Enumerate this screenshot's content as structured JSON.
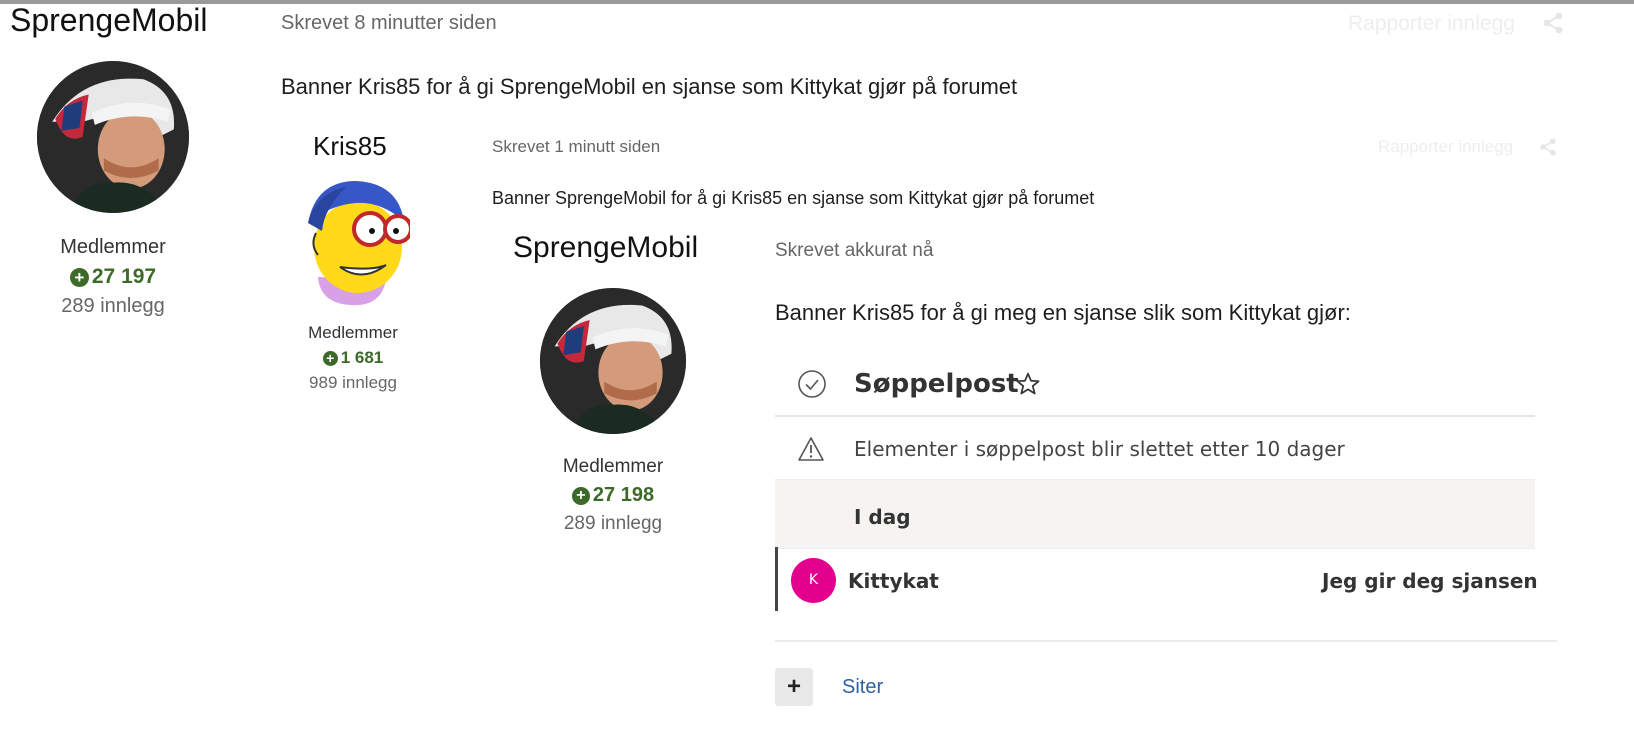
{
  "post1": {
    "author": "SprengeMobil",
    "time": "Skrevet 8 minutter siden",
    "report": "Rapporter innlegg",
    "group": "Medlemmer",
    "reputation": "27 197",
    "posts": "289 innlegg",
    "body": "Banner Kris85 for å gi SprengeMobil en sjanse som Kittykat gjør på forumet"
  },
  "post2": {
    "author": "Kris85",
    "time": "Skrevet 1 minutt siden",
    "report": "Rapporter innlegg",
    "group": "Medlemmer",
    "reputation": "1 681",
    "posts": "989 innlegg",
    "body": "Banner SprengeMobil for å gi Kris85 en sjanse som Kittykat gjør på forumet"
  },
  "post3": {
    "author": "SprengeMobil",
    "time": "Skrevet akkurat nå",
    "group": "Medlemmer",
    "reputation": "27 198",
    "posts": "289 innlegg",
    "body": "Banner Kris85 for å gi meg en sjanse slik som Kittykat gjør:"
  },
  "outlook": {
    "folder_title": "Søppelpost",
    "notice": "Elementer i søppelpost blir slettet etter 10 dager",
    "day_header": "I dag",
    "sender_initial": "K",
    "sender": "Kittykat",
    "subject": "Jeg gir deg sjansen",
    "sender_color": "#e3008c"
  },
  "quote": {
    "plus": "+",
    "label": "Siter"
  },
  "icons": {
    "share": "share-icon",
    "check": "check-circle-icon",
    "warning": "warning-icon",
    "star": "star-icon",
    "plus": "plus-circle-icon"
  }
}
